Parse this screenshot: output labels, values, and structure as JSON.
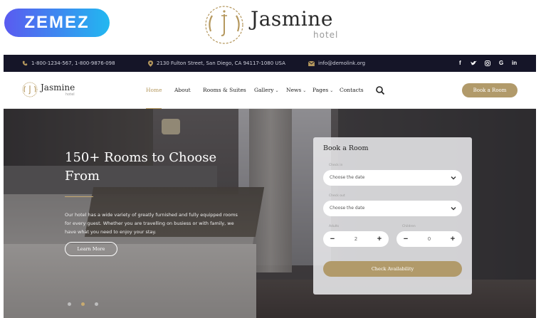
{
  "promo": {
    "badge": "ZEMEZ",
    "brand_name": "Jasmine",
    "brand_sub": "hotel"
  },
  "topbar": {
    "phone": "1-800-1234-567, 1-800-9876-098",
    "address": "2130 Fulton Street, San Diego, CA 94117-1080 USA",
    "email": "info@demolink.org",
    "social": [
      "f",
      "t",
      "ig",
      "G",
      "in"
    ]
  },
  "nav": {
    "logo_name": "Jasmine",
    "logo_sub": "hotel",
    "items": [
      {
        "label": "Home",
        "caret": ""
      },
      {
        "label": "About",
        "caret": ""
      },
      {
        "label": "Rooms & Suites",
        "caret": ""
      },
      {
        "label": "Gallery",
        "caret": "⌄"
      },
      {
        "label": "News",
        "caret": "⌄"
      },
      {
        "label": "Pages",
        "caret": "⌄"
      },
      {
        "label": "Contacts",
        "caret": ""
      }
    ],
    "book_button": "Book a Room"
  },
  "hero": {
    "title": "150+ Rooms to Choose From",
    "text": "Our hotel has a wide variety of greatly furnished and fully equipped rooms for every guest. Whether you are travelling on busiess or with family, we have what you need to enjoy your stay.",
    "button": "Learn More",
    "slides": 3,
    "active_slide": 2
  },
  "booking": {
    "title": "Book a Room",
    "check_in_label": "Check in",
    "check_in_value": "Choose the date",
    "check_out_label": "Check out",
    "check_out_value": "Choose the date",
    "adults_label": "Adults",
    "adults_value": "2",
    "children_label": "Children",
    "children_value": "0",
    "minus": "−",
    "plus": "+",
    "submit": "Check Availability"
  },
  "colors": {
    "accent": "#b19a6a",
    "topbar_bg": "#151528",
    "badge_gradient_start": "#5a5bf0",
    "badge_gradient_end": "#22b8f0"
  }
}
